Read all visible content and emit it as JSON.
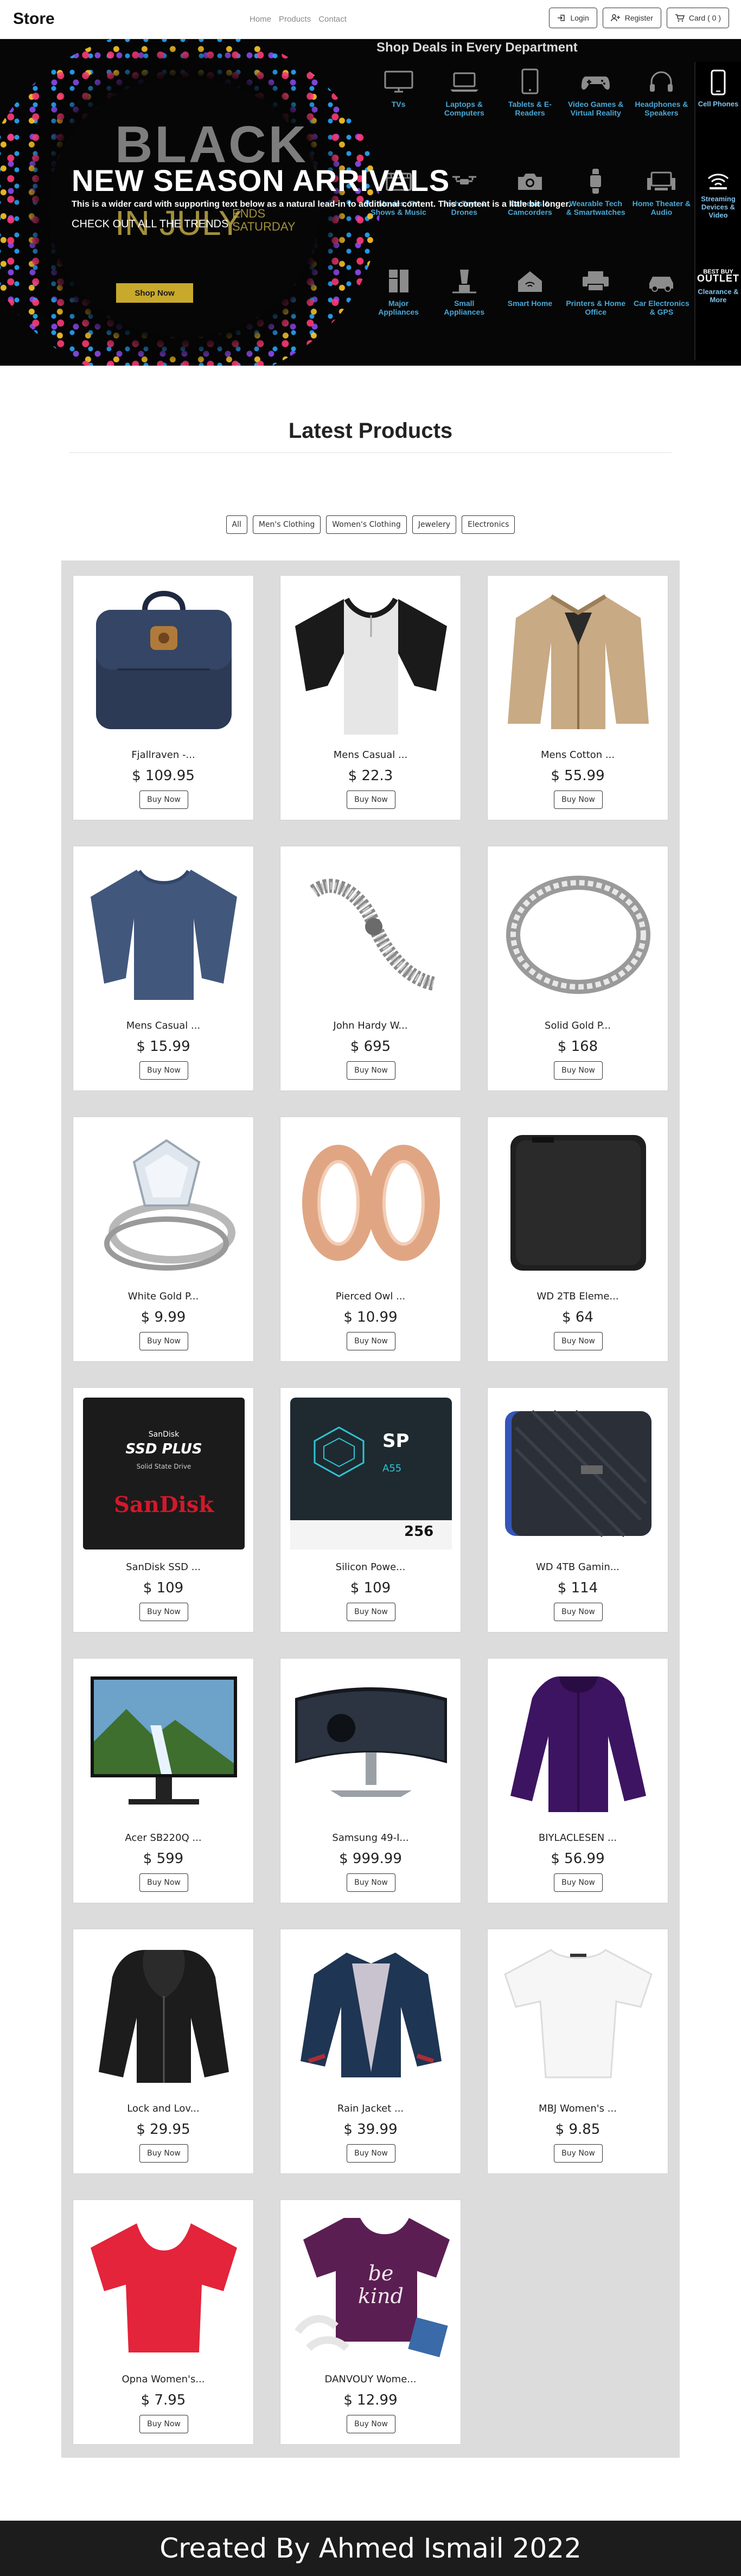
{
  "navbar": {
    "brand": "Store",
    "links": [
      "Home",
      "Products",
      "Contact"
    ],
    "login_label": "Login",
    "register_label": "Register",
    "cart_label": "Card ( 0 )"
  },
  "hero": {
    "title": "NEW SEASON ARRIVALS",
    "lead": "This is a wider card with supporting text below as a natural lead-in to additional content. This content is a little bit longer.",
    "link": "CHECK OUT ALL THE TRENDS",
    "banner_black": "BLACK",
    "banner_in_july": "IN JULY",
    "banner_ends": "ENDS",
    "banner_saturday": "SATURDAY",
    "banner_shop_now": "Shop Now",
    "deals_title": "Shop Deals in Every Department",
    "deals": [
      {
        "label": "TVs",
        "icon": "tv-icon"
      },
      {
        "label": "Laptops & Computers",
        "icon": "laptop-icon"
      },
      {
        "label": "Tablets & E-Readers",
        "icon": "tablet-icon"
      },
      {
        "label": "Video Games & Virtual Reality",
        "icon": "gamepad-icon"
      },
      {
        "label": "Headphones & Speakers",
        "icon": "headphones-icon"
      },
      {
        "label": "Movies, TV Shows & Music",
        "icon": "movie-icon"
      },
      {
        "label": "Tech Toys & Drones",
        "icon": "drone-icon"
      },
      {
        "label": "Cameras & Camcorders",
        "icon": "camera-icon"
      },
      {
        "label": "Wearable Tech & Smartwatches",
        "icon": "smartwatch-icon"
      },
      {
        "label": "Home Theater & Audio",
        "icon": "home-theater-icon"
      },
      {
        "label": "Major Appliances",
        "icon": "fridge-icon"
      },
      {
        "label": "Small Appliances",
        "icon": "blender-icon"
      },
      {
        "label": "Smart Home",
        "icon": "smart-home-icon"
      },
      {
        "label": "Printers & Home Office",
        "icon": "printer-icon"
      },
      {
        "label": "Car Electronics & GPS",
        "icon": "car-icon"
      }
    ],
    "side": [
      {
        "label": "Cell Phones",
        "icon": "cell-phone-icon"
      },
      {
        "label": "Streaming Devices & Video",
        "icon": "streaming-icon"
      },
      {
        "label": "Clearance & More",
        "icon": "outlet-icon",
        "logo_top": "BEST BUY",
        "logo_main": "OUTLET"
      }
    ]
  },
  "products_section": {
    "title": "Latest Products",
    "filters": [
      "All",
      "Men's Clothing",
      "Women's Clothing",
      "Jewelery",
      "Electronics"
    ],
    "buy_label": "Buy Now",
    "products": [
      {
        "title": "Fjallraven -...",
        "price": "$ 109.95",
        "icon": "backpack-icon"
      },
      {
        "title": "Mens Casual ...",
        "price": "$ 22.3",
        "icon": "tshirt-icon"
      },
      {
        "title": "Mens Cotton ...",
        "price": "$ 55.99",
        "icon": "jacket-icon"
      },
      {
        "title": "Mens Casual ...",
        "price": "$ 15.99",
        "icon": "tshirt-icon"
      },
      {
        "title": "John Hardy W...",
        "price": "$ 695",
        "icon": "bracelet-icon"
      },
      {
        "title": "Solid Gold P...",
        "price": "$ 168",
        "icon": "ring-icon"
      },
      {
        "title": "White Gold P...",
        "price": "$ 9.99",
        "icon": "ring-icon"
      },
      {
        "title": "Pierced Owl ...",
        "price": "$ 10.99",
        "icon": "ring-icon"
      },
      {
        "title": "WD 2TB Eleme...",
        "price": "$ 64",
        "icon": "hard-drive-icon"
      },
      {
        "title": "SanDisk SSD ...",
        "price": "$ 109",
        "icon": "ssd-icon",
        "img_line1": "SanDisk",
        "img_line2": "SSD PLUS",
        "img_line3": "Solid State Drive",
        "img_line4": "SanDisk"
      },
      {
        "title": "Silicon Powe...",
        "price": "$ 109",
        "icon": "ssd-icon",
        "img_line1": "SP",
        "img_line2": "A55",
        "img_line3": "256",
        "img_line4": ""
      },
      {
        "title": "WD 4TB Gamin...",
        "price": "$ 114",
        "icon": "hard-drive-icon"
      },
      {
        "title": "Acer SB220Q ...",
        "price": "$ 599",
        "icon": "monitor-icon"
      },
      {
        "title": "Samsung 49-I...",
        "price": "$ 999.99",
        "icon": "monitor-icon"
      },
      {
        "title": "BIYLACLESEN ...",
        "price": "$ 56.99",
        "icon": "jacket-icon"
      },
      {
        "title": "Lock and Lov...",
        "price": "$ 29.95",
        "icon": "jacket-icon"
      },
      {
        "title": "Rain Jacket ...",
        "price": "$ 39.99",
        "icon": "jacket-icon"
      },
      {
        "title": "MBJ Women's ...",
        "price": "$ 9.85",
        "icon": "tshirt-icon"
      },
      {
        "title": "Opna Women's...",
        "price": "$ 7.95",
        "icon": "tshirt-icon"
      },
      {
        "title": "DANVOUY Wome...",
        "price": "$ 12.99",
        "icon": "tshirt-icon",
        "img_line1": "be kind"
      }
    ]
  },
  "footer": {
    "text": "Created By Ahmed Ismail 2022"
  },
  "colors": {
    "navbar_bg": "#ffffff",
    "hero_bg": "#060606",
    "deal_label": "#4aa7d6",
    "panel_bg": "#dcdcdc",
    "footer_bg": "#1c1c1c"
  }
}
